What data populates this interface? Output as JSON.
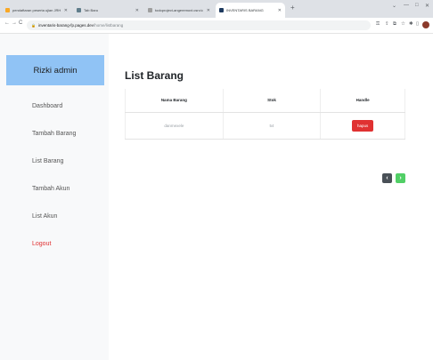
{
  "browser": {
    "tabs": [
      {
        "label": "pendaftaran peserta ujian JRHPro",
        "color": "#f9a825"
      },
      {
        "label": "Tab Baru",
        "color": "#607d8b"
      },
      {
        "label": "todoproject-angeremovt.csrv.io",
        "color": "#9e9e9e"
      },
      {
        "label": "INVENTARIS BARANG",
        "color": "#1e3a5f"
      }
    ],
    "url_host": "inventaris-barang-fp.pages.dev",
    "url_path": "/home/listbarang",
    "new_tab": "+"
  },
  "sidebar": {
    "header": "Rizki admin",
    "items": [
      {
        "label": "Dashboard"
      },
      {
        "label": "Tambah Barang"
      },
      {
        "label": "List Barang"
      },
      {
        "label": "Tambah Akun"
      },
      {
        "label": "List Akun"
      },
      {
        "label": "Logout"
      }
    ]
  },
  "main": {
    "title": "List Barang",
    "table": {
      "headers": [
        "Nama Barang",
        "Stok",
        "Handle"
      ],
      "rows": [
        {
          "name": "danmexele",
          "stok": "54",
          "action": "hapus"
        }
      ]
    },
    "pagination": {
      "prev": "‹",
      "next": "›"
    }
  },
  "colors": {
    "sidebar_header_bg": "#90c3f5",
    "logout": "#e03131",
    "delete_button": "#e03131",
    "next_button": "#51cf66",
    "prev_button": "#495057"
  }
}
